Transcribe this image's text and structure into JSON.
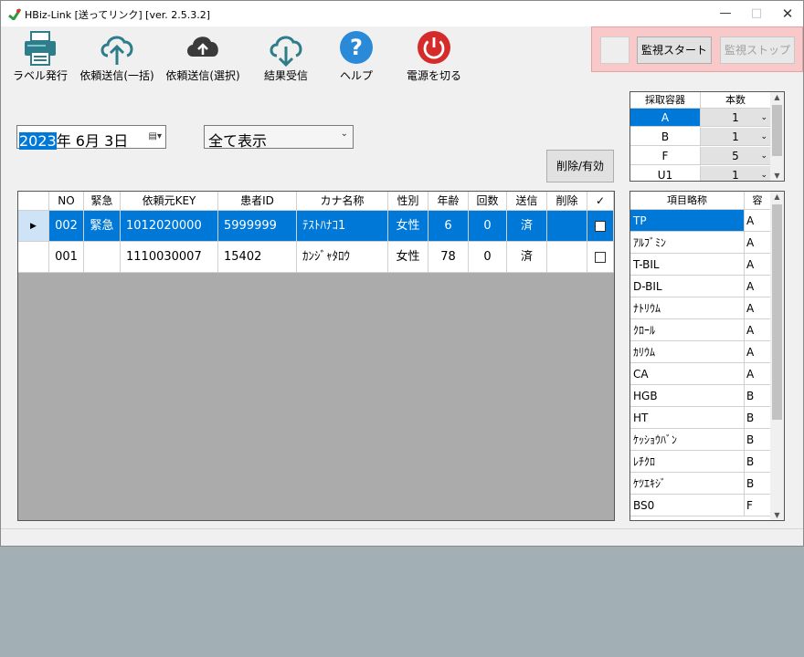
{
  "window": {
    "title": "HBiz-Link [送ってリンク] [ver. 2.5.3.2]"
  },
  "toolbar": {
    "buttons": [
      {
        "label": "ラベル発行",
        "icon": "printer-icon"
      },
      {
        "label": "依頼送信(一括)",
        "icon": "cloud-upload-icon"
      },
      {
        "label": "依頼送信(選択)",
        "icon": "cloud-upload-filled-icon"
      },
      {
        "label": "結果受信",
        "icon": "cloud-download-icon"
      },
      {
        "label": "ヘルプ",
        "icon": "help-icon"
      },
      {
        "label": "電源を切る",
        "icon": "power-icon"
      }
    ]
  },
  "monitor": {
    "start_label": "監視スタート",
    "stop_label": "監視ストップ"
  },
  "filters": {
    "date": {
      "year": "2023",
      "rest": "年  6月  3日"
    },
    "display_option": "全て表示"
  },
  "actions": {
    "delete_toggle_label": "削除/有効"
  },
  "grid": {
    "headers": [
      "NO",
      "緊急",
      "依頼元KEY",
      "患者ID",
      "カナ名称",
      "性別",
      "年齢",
      "回数",
      "送信",
      "削除",
      "✓"
    ],
    "rows": [
      {
        "no": "002",
        "urgent": "緊急",
        "key": "1012020000",
        "patient_id": "5999999",
        "kana": "ﾃｽﾄﾊﾅｺ1",
        "sex": "女性",
        "age": "6",
        "count": "0",
        "sent": "済",
        "deleted": "",
        "selected": true
      },
      {
        "no": "001",
        "urgent": "",
        "key": "1110030007",
        "patient_id": "15402",
        "kana": "ｶﾝｼﾞｬﾀﾛｳ",
        "sex": "女性",
        "age": "78",
        "count": "0",
        "sent": "済",
        "deleted": "",
        "selected": false
      }
    ]
  },
  "containers": {
    "headers": [
      "採取容器",
      "本数"
    ],
    "rows": [
      {
        "name": "A",
        "count": "1"
      },
      {
        "name": "B",
        "count": "1"
      },
      {
        "name": "F",
        "count": "5"
      },
      {
        "name": "U1",
        "count": "1"
      }
    ]
  },
  "items": {
    "headers": [
      "項目略称",
      "容"
    ],
    "rows": [
      {
        "name": "TP",
        "container": "A"
      },
      {
        "name": "ｱﾙﾌﾞﾐﾝ",
        "container": "A"
      },
      {
        "name": "T-BIL",
        "container": "A"
      },
      {
        "name": "D-BIL",
        "container": "A"
      },
      {
        "name": "ﾅﾄﾘｳﾑ",
        "container": "A"
      },
      {
        "name": "ｸﾛｰﾙ",
        "container": "A"
      },
      {
        "name": "ｶﾘｳﾑ",
        "container": "A"
      },
      {
        "name": "CA",
        "container": "A"
      },
      {
        "name": "HGB",
        "container": "B"
      },
      {
        "name": "HT",
        "container": "B"
      },
      {
        "name": "ｹｯｼｮｳﾊﾞﾝ",
        "container": "B"
      },
      {
        "name": "ﾚﾁｸﾛ",
        "container": "B"
      },
      {
        "name": "ｹﾂｴｷｼﾞ",
        "container": "B"
      },
      {
        "name": "BS0",
        "container": "F"
      }
    ]
  }
}
